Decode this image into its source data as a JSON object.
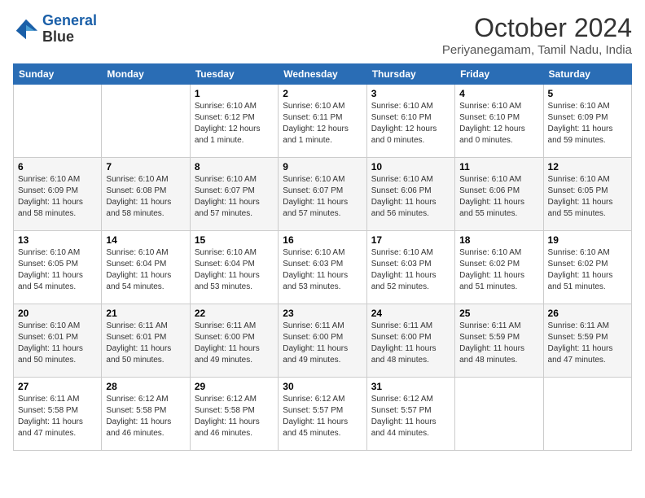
{
  "logo": {
    "line1": "General",
    "line2": "Blue"
  },
  "title": "October 2024",
  "subtitle": "Periyanegamam, Tamil Nadu, India",
  "days_header": [
    "Sunday",
    "Monday",
    "Tuesday",
    "Wednesday",
    "Thursday",
    "Friday",
    "Saturday"
  ],
  "weeks": [
    [
      {
        "day": "",
        "text": ""
      },
      {
        "day": "",
        "text": ""
      },
      {
        "day": "1",
        "text": "Sunrise: 6:10 AM\nSunset: 6:12 PM\nDaylight: 12 hours\nand 1 minute."
      },
      {
        "day": "2",
        "text": "Sunrise: 6:10 AM\nSunset: 6:11 PM\nDaylight: 12 hours\nand 1 minute."
      },
      {
        "day": "3",
        "text": "Sunrise: 6:10 AM\nSunset: 6:10 PM\nDaylight: 12 hours\nand 0 minutes."
      },
      {
        "day": "4",
        "text": "Sunrise: 6:10 AM\nSunset: 6:10 PM\nDaylight: 12 hours\nand 0 minutes."
      },
      {
        "day": "5",
        "text": "Sunrise: 6:10 AM\nSunset: 6:09 PM\nDaylight: 11 hours\nand 59 minutes."
      }
    ],
    [
      {
        "day": "6",
        "text": "Sunrise: 6:10 AM\nSunset: 6:09 PM\nDaylight: 11 hours\nand 58 minutes."
      },
      {
        "day": "7",
        "text": "Sunrise: 6:10 AM\nSunset: 6:08 PM\nDaylight: 11 hours\nand 58 minutes."
      },
      {
        "day": "8",
        "text": "Sunrise: 6:10 AM\nSunset: 6:07 PM\nDaylight: 11 hours\nand 57 minutes."
      },
      {
        "day": "9",
        "text": "Sunrise: 6:10 AM\nSunset: 6:07 PM\nDaylight: 11 hours\nand 57 minutes."
      },
      {
        "day": "10",
        "text": "Sunrise: 6:10 AM\nSunset: 6:06 PM\nDaylight: 11 hours\nand 56 minutes."
      },
      {
        "day": "11",
        "text": "Sunrise: 6:10 AM\nSunset: 6:06 PM\nDaylight: 11 hours\nand 55 minutes."
      },
      {
        "day": "12",
        "text": "Sunrise: 6:10 AM\nSunset: 6:05 PM\nDaylight: 11 hours\nand 55 minutes."
      }
    ],
    [
      {
        "day": "13",
        "text": "Sunrise: 6:10 AM\nSunset: 6:05 PM\nDaylight: 11 hours\nand 54 minutes."
      },
      {
        "day": "14",
        "text": "Sunrise: 6:10 AM\nSunset: 6:04 PM\nDaylight: 11 hours\nand 54 minutes."
      },
      {
        "day": "15",
        "text": "Sunrise: 6:10 AM\nSunset: 6:04 PM\nDaylight: 11 hours\nand 53 minutes."
      },
      {
        "day": "16",
        "text": "Sunrise: 6:10 AM\nSunset: 6:03 PM\nDaylight: 11 hours\nand 53 minutes."
      },
      {
        "day": "17",
        "text": "Sunrise: 6:10 AM\nSunset: 6:03 PM\nDaylight: 11 hours\nand 52 minutes."
      },
      {
        "day": "18",
        "text": "Sunrise: 6:10 AM\nSunset: 6:02 PM\nDaylight: 11 hours\nand 51 minutes."
      },
      {
        "day": "19",
        "text": "Sunrise: 6:10 AM\nSunset: 6:02 PM\nDaylight: 11 hours\nand 51 minutes."
      }
    ],
    [
      {
        "day": "20",
        "text": "Sunrise: 6:10 AM\nSunset: 6:01 PM\nDaylight: 11 hours\nand 50 minutes."
      },
      {
        "day": "21",
        "text": "Sunrise: 6:11 AM\nSunset: 6:01 PM\nDaylight: 11 hours\nand 50 minutes."
      },
      {
        "day": "22",
        "text": "Sunrise: 6:11 AM\nSunset: 6:00 PM\nDaylight: 11 hours\nand 49 minutes."
      },
      {
        "day": "23",
        "text": "Sunrise: 6:11 AM\nSunset: 6:00 PM\nDaylight: 11 hours\nand 49 minutes."
      },
      {
        "day": "24",
        "text": "Sunrise: 6:11 AM\nSunset: 6:00 PM\nDaylight: 11 hours\nand 48 minutes."
      },
      {
        "day": "25",
        "text": "Sunrise: 6:11 AM\nSunset: 5:59 PM\nDaylight: 11 hours\nand 48 minutes."
      },
      {
        "day": "26",
        "text": "Sunrise: 6:11 AM\nSunset: 5:59 PM\nDaylight: 11 hours\nand 47 minutes."
      }
    ],
    [
      {
        "day": "27",
        "text": "Sunrise: 6:11 AM\nSunset: 5:58 PM\nDaylight: 11 hours\nand 47 minutes."
      },
      {
        "day": "28",
        "text": "Sunrise: 6:12 AM\nSunset: 5:58 PM\nDaylight: 11 hours\nand 46 minutes."
      },
      {
        "day": "29",
        "text": "Sunrise: 6:12 AM\nSunset: 5:58 PM\nDaylight: 11 hours\nand 46 minutes."
      },
      {
        "day": "30",
        "text": "Sunrise: 6:12 AM\nSunset: 5:57 PM\nDaylight: 11 hours\nand 45 minutes."
      },
      {
        "day": "31",
        "text": "Sunrise: 6:12 AM\nSunset: 5:57 PM\nDaylight: 11 hours\nand 44 minutes."
      },
      {
        "day": "",
        "text": ""
      },
      {
        "day": "",
        "text": ""
      }
    ]
  ]
}
